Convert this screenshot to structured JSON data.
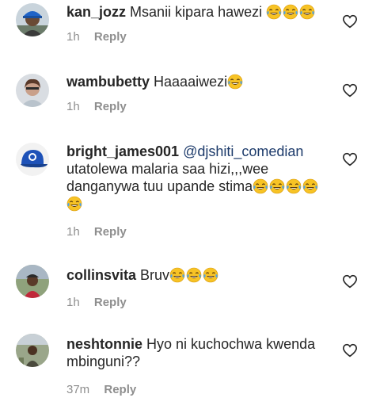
{
  "comments": [
    {
      "username": "kan_jozz",
      "text": "Msanii kipara hawezi",
      "mention": "",
      "emoji_count": 3,
      "emoji_trailing_count": 0,
      "time": "1h",
      "reply_label": "Reply",
      "avatar": "avatar-blue-hat"
    },
    {
      "username": "wambubetty",
      "text": "Haaaaiwezi",
      "mention": "",
      "emoji_count": 1,
      "emoji_trailing_count": 0,
      "time": "1h",
      "reply_label": "Reply",
      "avatar": "avatar-woman-selfie"
    },
    {
      "username": "bright_james001",
      "mention": "@djshiti_comedian",
      "text_line1": "utatolewa malaria saa hizi,,,wee",
      "text_line2": "danganywa tuu upande stima",
      "emoji_count": 4,
      "emoji_trailing_count": 1,
      "time": "1h",
      "reply_label": "Reply",
      "avatar": "avatar-chelsea-cap"
    },
    {
      "username": "collinsvita",
      "text": "Bruv",
      "mention": "",
      "emoji_count": 3,
      "emoji_trailing_count": 0,
      "time": "1h",
      "reply_label": "Reply",
      "avatar": "avatar-person-red"
    },
    {
      "username": "neshtonnie",
      "text_line1": "Hyo ni kuchochwa kwenda",
      "text_line2": "mbinguni??",
      "mention": "",
      "emoji_count": 0,
      "emoji_trailing_count": 0,
      "time": "37m",
      "reply_label": "Reply",
      "avatar": "avatar-person-outdoor"
    }
  ],
  "icons": {
    "like": "heart-outline-icon",
    "emoji": "face-with-tears-of-joy-emoji"
  },
  "colors": {
    "text": "#262626",
    "meta": "#8e8e8e",
    "mention": "#1d3b6b",
    "emoji_face": "#f7c325"
  }
}
